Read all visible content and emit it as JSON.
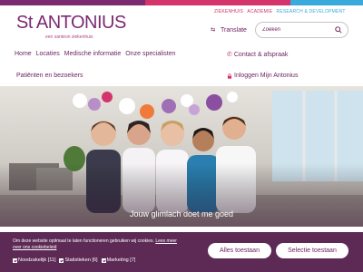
{
  "brand": {
    "logo_text": "St ANTONIUS",
    "tagline": "een santeon ziekenhuis"
  },
  "top_links": [
    "ZIEKENHUIS",
    "ACADEMIE",
    "RESEARCH & DEVELOPMENT"
  ],
  "translate": {
    "label": "Translate"
  },
  "search": {
    "placeholder": "Zoeken"
  },
  "nav": {
    "items": [
      "Home",
      "Locaties",
      "Medische informatie",
      "Onze specialisten"
    ],
    "second_row": "Patiënten en bezoekers",
    "contact": "Contact & afspraak",
    "login": "Inloggen Mijn Antonius"
  },
  "hero": {
    "caption": "Jouw glimlach doet me goed"
  },
  "cookie": {
    "text": "Om deze website optimaal te laten functioneren gebruiken wij cookies.",
    "link": "Lees meer over ons cookiebeleid",
    "options": [
      {
        "label": "Noodzakelijk [11]",
        "checked": true
      },
      {
        "label": "Statistieken [6]",
        "checked": true
      },
      {
        "label": "Marketing [7]",
        "checked": true
      }
    ],
    "accept_all": "Alles toestaan",
    "accept_selection": "Selectie toestaan"
  },
  "colors": {
    "brand_purple": "#7b2a72",
    "brand_pink": "#d3346b",
    "brand_blue": "#3aa9dc",
    "cookie_bg": "#5c2a55"
  }
}
